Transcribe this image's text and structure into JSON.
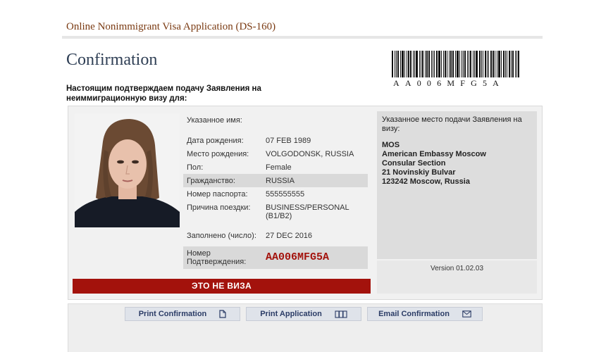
{
  "header": {
    "app_title": "Online Nonimmigrant Visa Application (DS-160)",
    "page_title": "Confirmation"
  },
  "barcode": {
    "text": "AA006MFG5A"
  },
  "intro_text": "Настоящим подтверждаем подачу Заявления на неиммиграционную визу для:",
  "applicant": {
    "fields": [
      {
        "label": "Указанное имя:",
        "value": ""
      },
      {
        "label": "Дата рождения:",
        "value": "07 FEB 1989"
      },
      {
        "label": "Место рождения:",
        "value": "VOLGODONSK, RUSSIA"
      },
      {
        "label": "Пол:",
        "value": "Female"
      },
      {
        "label": "Гражданство:",
        "value": "RUSSIA"
      },
      {
        "label": "Номер паспорта:",
        "value": "555555555"
      },
      {
        "label": "Причина поездки:",
        "value": "BUSINESS/PERSONAL (B1/B2)"
      },
      {
        "label": "Заполнено (число):",
        "value": "27 DEC 2016"
      },
      {
        "label": "Номер Подтверждения:",
        "value": "AA006MFG5A"
      }
    ]
  },
  "not_visa_banner": "ЭТО НЕ ВИЗА",
  "location": {
    "label": "Указанное место подачи Заявления на визу:",
    "code": "MOS",
    "address_lines": [
      "American Embassy Moscow",
      "Consular Section",
      "21 Novinskiy Bulvar",
      "123242 Moscow, Russia"
    ]
  },
  "version": "Version 01.02.03",
  "actions": {
    "print_confirmation": "Print Confirmation",
    "print_application": "Print Application",
    "email_confirmation": "Email Confirmation"
  },
  "colors": {
    "banner": "#a3120c",
    "confirmation_number": "#a3120c",
    "title_brown": "#7a3a12",
    "button_text": "#2b3c66"
  },
  "icons": [
    "document-icon",
    "pages-icon",
    "envelope-icon"
  ]
}
